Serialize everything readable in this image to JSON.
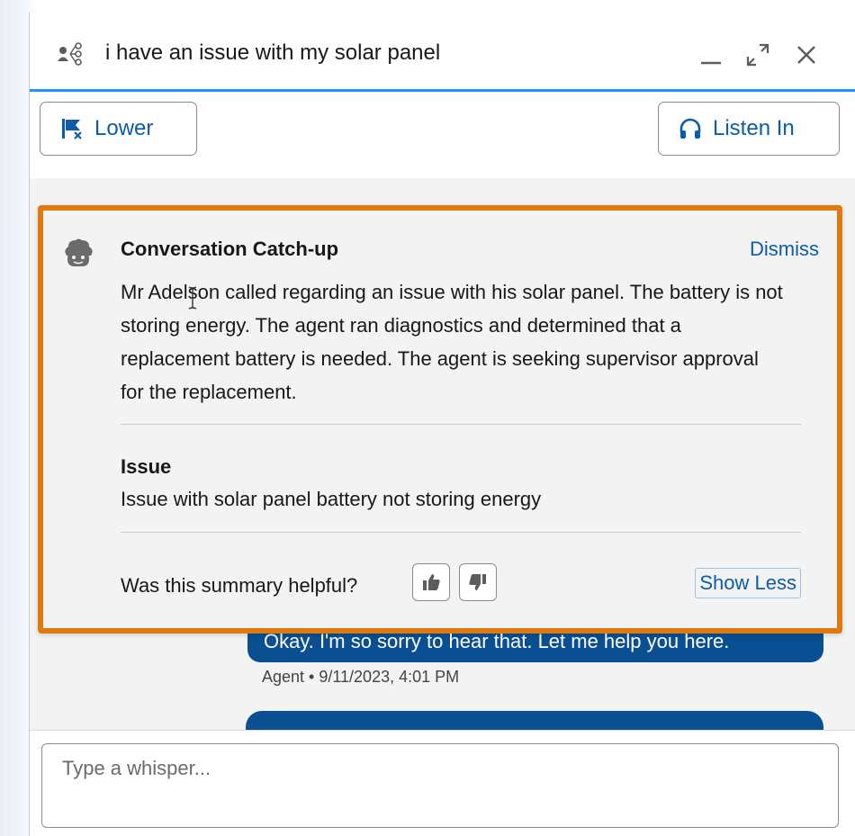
{
  "header": {
    "title": "i have an issue with my solar panel"
  },
  "toolbar": {
    "lower_label": "Lower",
    "listen_label": "Listen In"
  },
  "catchup": {
    "title": "Conversation Catch-up",
    "dismiss_label": "Dismiss",
    "summary": "Mr Adelson called regarding an issue with his solar panel. The battery is not storing energy. The agent ran diagnostics and determined that a replacement battery is needed. The agent is seeking supervisor approval for the replacement.",
    "issue_label": "Issue",
    "issue_value": "Issue with solar panel battery not storing energy",
    "helpful_prompt": "Was this summary helpful?",
    "show_less_label": "Show Less"
  },
  "feed": {
    "bubble_text": "Okay. I'm so sorry to hear that. Let me help you here.",
    "meta": "Agent • 9/11/2023, 4:01 PM"
  },
  "composer": {
    "placeholder": "Type a whisper..."
  },
  "colors": {
    "accent": "#0b5cab",
    "highlight_border": "#e07a10",
    "header_rule": "#1b96ff",
    "bubble": "#0b4f93"
  },
  "icons": {
    "header": "thread-icon",
    "lower": "flag-x-icon",
    "listen": "headphones-icon",
    "bot": "einstein-bot-icon",
    "up": "thumbs-up-icon",
    "down": "thumbs-down-icon"
  }
}
